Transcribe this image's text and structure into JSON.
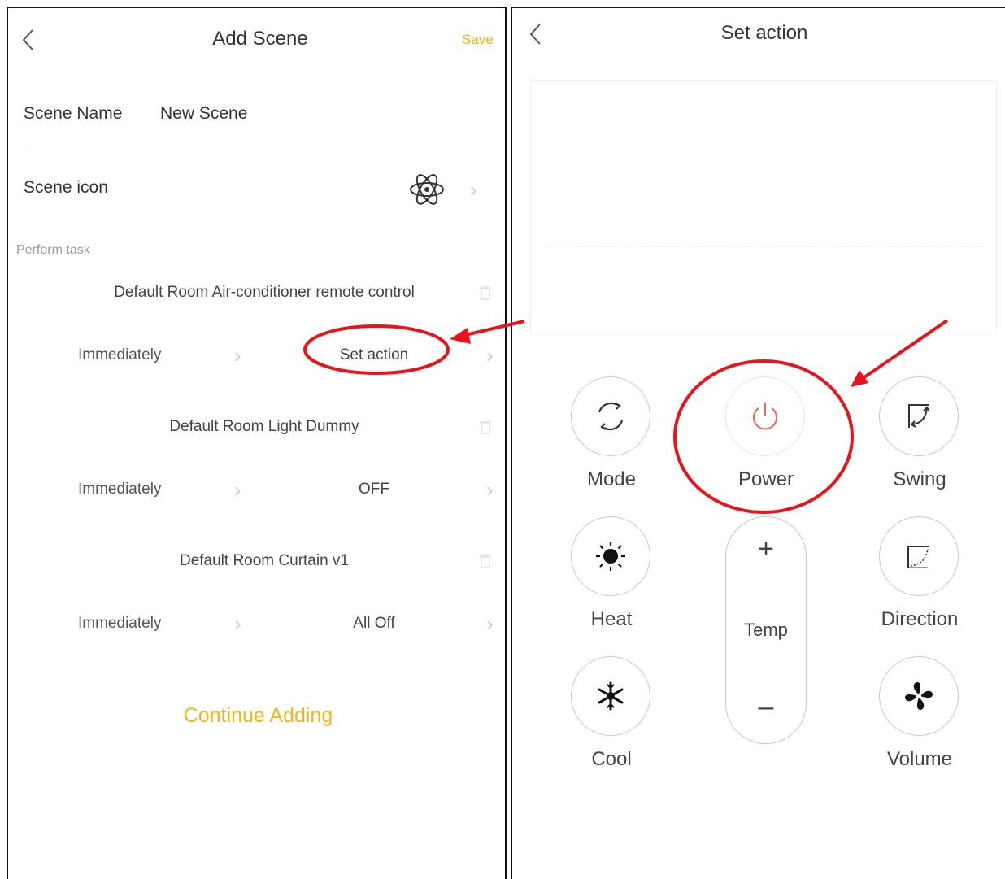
{
  "add_scene": {
    "back_icon": "chevron-left-icon",
    "title": "Add Scene",
    "save_label": "Save",
    "scene_name_label": "Scene Name",
    "scene_name_value": "New Scene",
    "scene_icon_label": "Scene icon",
    "scene_icon": "atom-icon",
    "perform_task_label": "Perform task",
    "tasks": [
      {
        "device": "Default Room Air-conditioner remote control",
        "timing": "Immediately",
        "action": "Set action"
      },
      {
        "device": "Default Room Light Dummy",
        "timing": "Immediately",
        "action": "OFF"
      },
      {
        "device": "Default Room Curtain v1",
        "timing": "Immediately",
        "action": "All Off"
      }
    ],
    "continue_label": "Continue Adding"
  },
  "set_action": {
    "back_icon": "chevron-left-icon",
    "title": "Set action",
    "buttons": {
      "mode": {
        "label": "Mode",
        "icon": "cycle-arrows-icon"
      },
      "power": {
        "label": "Power",
        "icon": "power-icon"
      },
      "swing": {
        "label": "Swing",
        "icon": "swing-icon"
      },
      "heat": {
        "label": "Heat",
        "icon": "sun-icon"
      },
      "direction": {
        "label": "Direction",
        "icon": "direction-icon"
      },
      "cool": {
        "label": "Cool",
        "icon": "snowflake-icon"
      },
      "volume": {
        "label": "Volume",
        "icon": "fan-icon"
      }
    },
    "temp": {
      "label": "Temp",
      "plus": "+",
      "minus": "–"
    }
  },
  "colors": {
    "accent": "#f5b31c",
    "annotation": "#e8141b",
    "power": "#e86a5a"
  }
}
